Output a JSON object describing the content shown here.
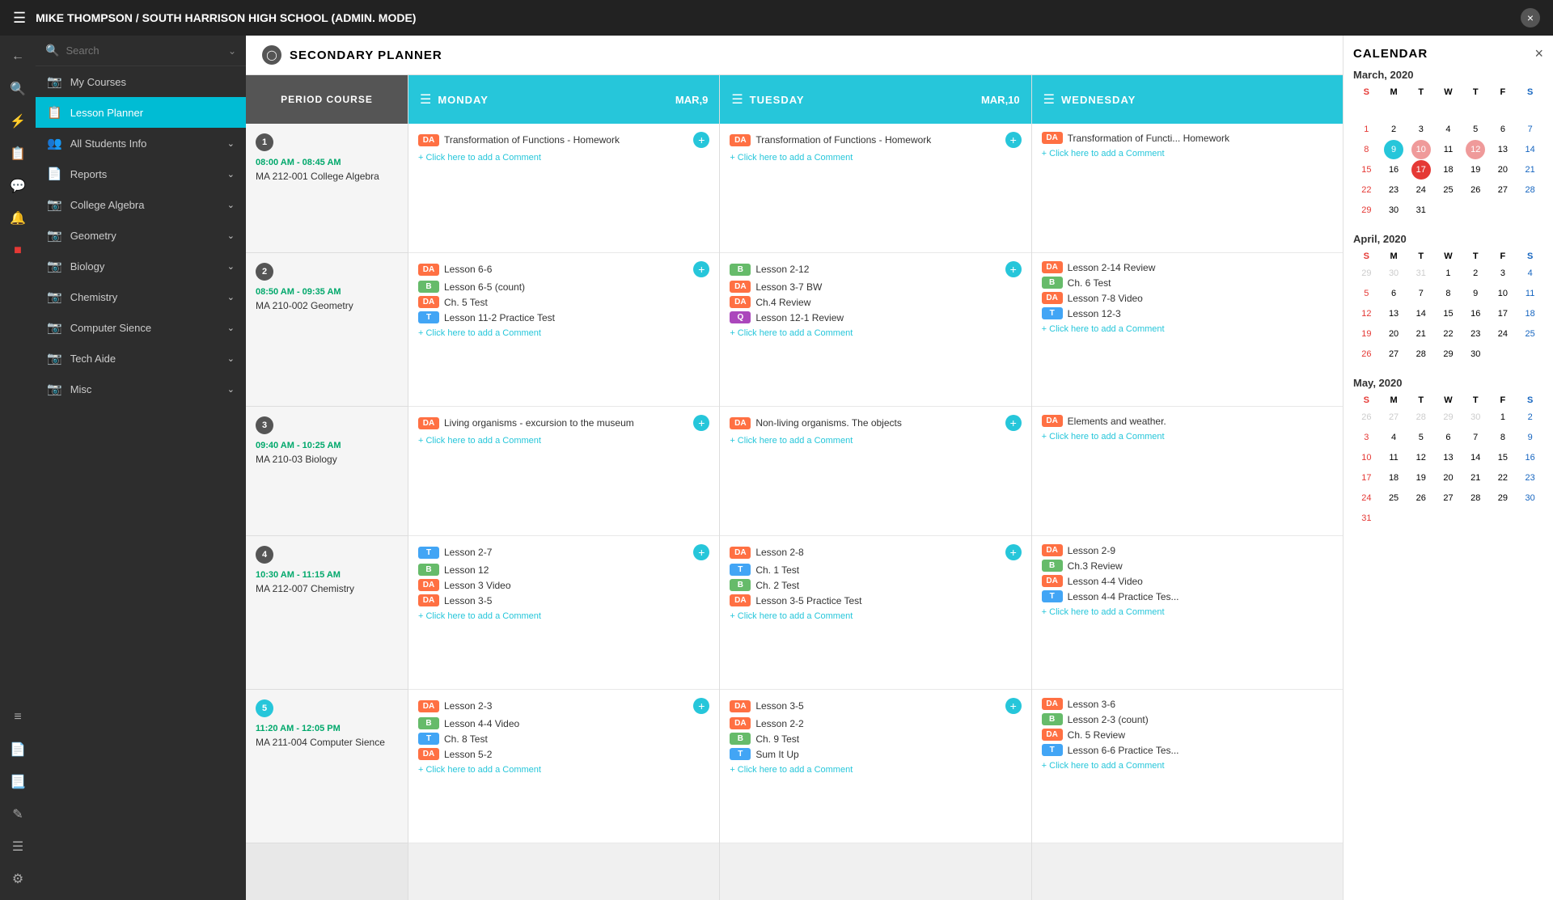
{
  "topbar": {
    "title": "MIKE THOMPSON / SOUTH HARRISON HIGH SCHOOL (ADMIN. MODE)",
    "close_label": "×"
  },
  "sidebar": {
    "search_placeholder": "Search",
    "items": [
      {
        "id": "my-courses",
        "label": "My Courses",
        "icon": "🗂"
      },
      {
        "id": "lesson-planner",
        "label": "Lesson Planner",
        "icon": "📋",
        "active": true
      },
      {
        "id": "all-students",
        "label": "All Students Info",
        "icon": "👥",
        "expandable": true
      },
      {
        "id": "reports",
        "label": "Reports",
        "icon": "📄",
        "expandable": true
      },
      {
        "id": "college-algebra",
        "label": "College Algebra",
        "icon": "🗂",
        "expandable": true
      },
      {
        "id": "geometry",
        "label": "Geometry",
        "icon": "🗂",
        "expandable": true
      },
      {
        "id": "biology",
        "label": "Biology",
        "icon": "🗂",
        "expandable": true
      },
      {
        "id": "chemistry",
        "label": "Chemistry",
        "icon": "🗂",
        "expandable": true
      },
      {
        "id": "computer-sience",
        "label": "Computer Sience",
        "icon": "🗂",
        "expandable": true
      },
      {
        "id": "tech-aide",
        "label": "Tech Aide",
        "icon": "🗂",
        "expandable": true
      },
      {
        "id": "misc",
        "label": "Misc",
        "icon": "🗂",
        "expandable": true
      }
    ]
  },
  "planner": {
    "title": "SECONDARY PLANNER",
    "col_header": "PERIOD COURSE",
    "days": [
      {
        "name": "MONDAY",
        "date": "MAR,9"
      },
      {
        "name": "TUESDAY",
        "date": "MAR,10"
      },
      {
        "name": "WEDNESDAY",
        "date": ""
      }
    ],
    "periods": [
      {
        "num": "1",
        "time": "08:00 AM - 08:45 AM",
        "course": "MA 212-001 College Algebra",
        "mon": {
          "lessons": [
            {
              "badge": "DA",
              "badge_type": "da",
              "text": "Transformation of Functions - Homework",
              "add": true
            }
          ],
          "comment": "Click here to add a Comment"
        },
        "tue": {
          "lessons": [
            {
              "badge": "DA",
              "badge_type": "da",
              "text": "Transformation of Functions - Homework",
              "add": true
            }
          ],
          "comment": "Click here to add a Comment"
        },
        "wed": {
          "lessons": [
            {
              "badge": "DA",
              "badge_type": "da",
              "text": "Transformation of Functi... Homework"
            }
          ],
          "comment": "Click here to add a Comment"
        }
      },
      {
        "num": "2",
        "time": "08:50 AM - 09:35 AM",
        "course": "MA 210-002 Geometry",
        "mon": {
          "lessons": [
            {
              "badge": "DA",
              "badge_type": "da",
              "text": "Lesson 6-6",
              "add": true
            },
            {
              "badge": "B",
              "badge_type": "b",
              "text": "Lesson 6-5 (count)"
            },
            {
              "badge": "DA",
              "badge_type": "da",
              "text": "Ch. 5 Test"
            },
            {
              "badge": "T",
              "badge_type": "t",
              "text": "Lesson 11-2 Practice Test"
            }
          ],
          "comment": "Click here to add a Comment"
        },
        "tue": {
          "lessons": [
            {
              "badge": "B",
              "badge_type": "b",
              "text": "Lesson 2-12",
              "add": true
            },
            {
              "badge": "DA",
              "badge_type": "da",
              "text": "Lesson 3-7 BW"
            },
            {
              "badge": "DA",
              "badge_type": "da",
              "text": "Ch.4 Review"
            },
            {
              "badge": "Q",
              "badge_type": "q",
              "text": "Lesson 12-1 Review"
            }
          ],
          "comment": "Click here to add a Comment"
        },
        "wed": {
          "lessons": [
            {
              "badge": "DA",
              "badge_type": "da",
              "text": "Lesson 2-14 Review"
            },
            {
              "badge": "B",
              "badge_type": "b",
              "text": "Ch. 6 Test"
            },
            {
              "badge": "DA",
              "badge_type": "da",
              "text": "Lesson 7-8 Video"
            },
            {
              "badge": "T",
              "badge_type": "t",
              "text": "Lesson 12-3"
            }
          ],
          "comment": "Click here to add a Comment"
        }
      },
      {
        "num": "3",
        "time": "09:40 AM - 10:25 AM",
        "course": "MA 210-03 Biology",
        "mon": {
          "lessons": [
            {
              "badge": "DA",
              "badge_type": "da",
              "text": "Living organisms - excursion to the museum",
              "add": true
            }
          ],
          "comment": "Click here to add a Comment"
        },
        "tue": {
          "lessons": [
            {
              "badge": "DA",
              "badge_type": "da",
              "text": "Non-living organisms. The objects",
              "add": true
            }
          ],
          "comment": "Click here to add a Comment"
        },
        "wed": {
          "lessons": [
            {
              "badge": "DA",
              "badge_type": "da",
              "text": "Elements and weather."
            }
          ],
          "comment": "Click here to add a Comment"
        }
      },
      {
        "num": "4",
        "time": "10:30 AM - 11:15 AM",
        "course": "MA 212-007 Chemistry",
        "mon": {
          "lessons": [
            {
              "badge": "T",
              "badge_type": "t",
              "text": "Lesson 2-7",
              "add": true
            },
            {
              "badge": "B",
              "badge_type": "b",
              "text": "Lesson 12"
            },
            {
              "badge": "DA",
              "badge_type": "da",
              "text": "Lesson 3 Video"
            },
            {
              "badge": "DA",
              "badge_type": "da",
              "text": "Lesson 3-5"
            }
          ],
          "comment": "Click here to add a Comment"
        },
        "tue": {
          "lessons": [
            {
              "badge": "DA",
              "badge_type": "da",
              "text": "Lesson 2-8",
              "add": true
            },
            {
              "badge": "T",
              "badge_type": "t",
              "text": "Ch. 1 Test"
            },
            {
              "badge": "B",
              "badge_type": "b",
              "text": "Ch. 2 Test"
            },
            {
              "badge": "DA",
              "badge_type": "da",
              "text": "Lesson 3-5 Practice Test"
            }
          ],
          "comment": "Click here to add a Comment"
        },
        "wed": {
          "lessons": [
            {
              "badge": "DA",
              "badge_type": "da",
              "text": "Lesson 2-9"
            },
            {
              "badge": "B",
              "badge_type": "b",
              "text": "Ch.3 Review"
            },
            {
              "badge": "DA",
              "badge_type": "da",
              "text": "Lesson 4-4 Video"
            },
            {
              "badge": "T",
              "badge_type": "t",
              "text": "Lesson 4-4 Practice Tes..."
            }
          ],
          "comment": "Click here to add a Comment"
        }
      },
      {
        "num": "5",
        "time": "11:20 AM - 12:05 PM",
        "course": "MA 211-004 Computer Sience",
        "mon": {
          "lessons": [
            {
              "badge": "DA",
              "badge_type": "da",
              "text": "Lesson 2-3",
              "add": true
            },
            {
              "badge": "B",
              "badge_type": "b",
              "text": "Lesson 4-4 Video"
            },
            {
              "badge": "T",
              "badge_type": "t",
              "text": "Ch. 8 Test"
            },
            {
              "badge": "DA",
              "badge_type": "da",
              "text": "Lesson 5-2"
            }
          ],
          "comment": "Click here to add a Comment"
        },
        "tue": {
          "lessons": [
            {
              "badge": "DA",
              "badge_type": "da",
              "text": "Lesson 3-5",
              "add": true
            },
            {
              "badge": "DA",
              "badge_type": "da",
              "text": "Lesson 2-2"
            },
            {
              "badge": "B",
              "badge_type": "b",
              "text": "Ch. 9 Test"
            },
            {
              "badge": "T",
              "badge_type": "t",
              "text": "Sum It Up"
            }
          ],
          "comment": "Click here to add a Comment"
        },
        "wed": {
          "lessons": [
            {
              "badge": "DA",
              "badge_type": "da",
              "text": "Lesson 3-6"
            },
            {
              "badge": "B",
              "badge_type": "b",
              "text": "Lesson 2-3 (count)"
            },
            {
              "badge": "DA",
              "badge_type": "da",
              "text": "Ch. 5 Review"
            },
            {
              "badge": "T",
              "badge_type": "t",
              "text": "Lesson 6-6 Practice Tes..."
            }
          ],
          "comment": "Click here to add a Comment"
        }
      }
    ]
  },
  "calendar": {
    "title": "CALENDAR",
    "close_label": "×",
    "months": [
      {
        "name": "March, 2020",
        "dows": [
          "S",
          "M",
          "T",
          "W",
          "T",
          "F",
          "S"
        ],
        "weeks": [
          [
            "",
            "",
            "",
            "",
            "",
            "",
            ""
          ],
          [
            "1",
            "2",
            "3",
            "4",
            "5",
            "6",
            "7"
          ],
          [
            "8",
            "9",
            "10",
            "11",
            "12",
            "13",
            "14"
          ],
          [
            "15",
            "16",
            "17",
            "18",
            "19",
            "20",
            "21"
          ],
          [
            "22",
            "23",
            "24",
            "25",
            "26",
            "27",
            "28"
          ],
          [
            "29",
            "30",
            "31",
            "",
            "",
            "",
            ""
          ]
        ],
        "today": "9",
        "selected": "17",
        "highlighted": "9"
      },
      {
        "name": "April, 2020",
        "dows": [
          "S",
          "M",
          "T",
          "W",
          "T",
          "F",
          "S"
        ],
        "weeks": [
          [
            "",
            "",
            "",
            "1",
            "2",
            "3",
            "4"
          ],
          [
            "5",
            "6",
            "7",
            "8",
            "9",
            "10",
            "11"
          ],
          [
            "12",
            "13",
            "14",
            "15",
            "16",
            "17",
            "18"
          ],
          [
            "19",
            "20",
            "21",
            "22",
            "23",
            "24",
            "25"
          ],
          [
            "26",
            "27",
            "28",
            "29",
            "30",
            "",
            ""
          ]
        ]
      },
      {
        "name": "May, 2020",
        "dows": [
          "S",
          "M",
          "T",
          "W",
          "T",
          "F",
          "S"
        ],
        "weeks": [
          [
            "",
            "",
            "",
            "",
            "",
            "1",
            "2"
          ],
          [
            "3",
            "4",
            "5",
            "6",
            "7",
            "8",
            "9"
          ],
          [
            "10",
            "11",
            "12",
            "13",
            "14",
            "15",
            "16"
          ],
          [
            "17",
            "18",
            "19",
            "20",
            "21",
            "22",
            "23"
          ],
          [
            "24",
            "25",
            "26",
            "27",
            "28",
            "29",
            "30"
          ],
          [
            "31",
            "",
            "",
            "",
            "",
            "",
            ""
          ]
        ]
      }
    ]
  }
}
